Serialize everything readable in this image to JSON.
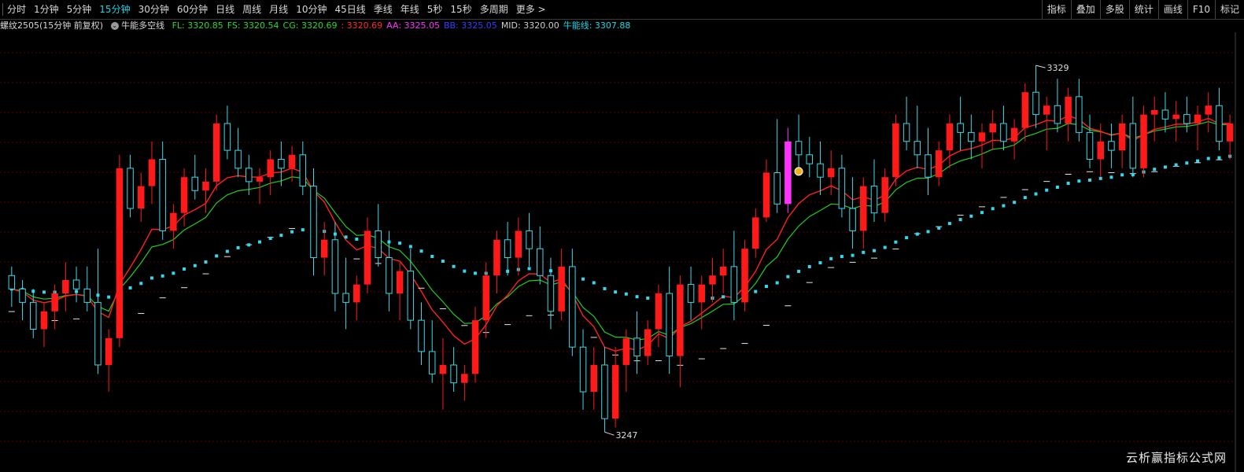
{
  "toolbar": {
    "periods": [
      "分时",
      "1分钟",
      "5分钟",
      "15分钟",
      "30分钟",
      "60分钟",
      "日线",
      "周线",
      "月线",
      "10分钟",
      "45日线",
      "季线",
      "年线",
      "5秒",
      "15秒",
      "多周期",
      "更多 >"
    ],
    "active_index": 3,
    "right_tools": [
      "指标",
      "叠加",
      "多股",
      "统计",
      "画线",
      "F10",
      "标记"
    ]
  },
  "legend": {
    "symbol": "螺纹2505(15分钟 前复权)",
    "indicator_name": "牛能多空线",
    "items": [
      {
        "text": "FL: 3320.85",
        "color": "#2ed62e"
      },
      {
        "text": "FS: 3320.54",
        "color": "#2ed62e"
      },
      {
        "text": "CG: 3320.69",
        "color": "#2ed62e"
      },
      {
        "text": ": 3320.69",
        "color": "#ff2a2a"
      },
      {
        "text": "AA: 3325.05",
        "color": "#ff33ff"
      },
      {
        "text": "BB: 3325.05",
        "color": "#3b3bff"
      },
      {
        "text": "MID: 3320.00",
        "color": "#cfcfcf"
      },
      {
        "text": "牛能线: 3307.88",
        "color": "#19d5e6"
      }
    ]
  },
  "colors": {
    "up": "#ff1a1a",
    "down": "#3dd9e8",
    "fast_line": "#ff2020",
    "slow_line": "#22cc22",
    "dotted_line": "#34d8ec",
    "step_marks": "#e6e6e6",
    "grid": "#5a0000",
    "signal_bar": "#ff33ff"
  },
  "chart_data": {
    "type": "candlestick",
    "title": "螺纹2505(15分钟 前复权)",
    "ylim": [
      3240,
      3335
    ],
    "high_label": "3329",
    "low_label": "3247",
    "candles": [
      [
        3282,
        3284,
        3275,
        3279
      ],
      [
        3279,
        3281,
        3272,
        3276
      ],
      [
        3276,
        3279,
        3268,
        3270
      ],
      [
        3270,
        3276,
        3266,
        3274
      ],
      [
        3274,
        3280,
        3270,
        3278
      ],
      [
        3278,
        3285,
        3274,
        3281
      ],
      [
        3281,
        3284,
        3276,
        3279
      ],
      [
        3279,
        3284,
        3274,
        3276
      ],
      [
        3276,
        3288,
        3260,
        3262
      ],
      [
        3262,
        3270,
        3256,
        3268
      ],
      [
        3268,
        3309,
        3266,
        3306
      ],
      [
        3306,
        3309,
        3295,
        3297
      ],
      [
        3297,
        3305,
        3294,
        3302
      ],
      [
        3302,
        3312,
        3298,
        3308
      ],
      [
        3308,
        3312,
        3290,
        3292
      ],
      [
        3292,
        3298,
        3288,
        3296
      ],
      [
        3296,
        3306,
        3293,
        3304
      ],
      [
        3304,
        3309,
        3299,
        3301
      ],
      [
        3301,
        3306,
        3296,
        3303
      ],
      [
        3303,
        3318,
        3301,
        3316
      ],
      [
        3316,
        3320,
        3308,
        3310
      ],
      [
        3310,
        3315,
        3304,
        3306
      ],
      [
        3306,
        3309,
        3300,
        3303
      ],
      [
        3303,
        3306,
        3298,
        3304
      ],
      [
        3304,
        3310,
        3300,
        3308
      ],
      [
        3308,
        3312,
        3302,
        3306
      ],
      [
        3306,
        3311,
        3303,
        3309
      ],
      [
        3309,
        3312,
        3300,
        3302
      ],
      [
        3302,
        3306,
        3282,
        3286
      ],
      [
        3286,
        3294,
        3282,
        3290
      ],
      [
        3290,
        3294,
        3274,
        3278
      ],
      [
        3278,
        3286,
        3270,
        3276
      ],
      [
        3276,
        3282,
        3272,
        3280
      ],
      [
        3280,
        3295,
        3278,
        3292
      ],
      [
        3292,
        3298,
        3284,
        3286
      ],
      [
        3286,
        3292,
        3274,
        3278
      ],
      [
        3278,
        3285,
        3272,
        3283
      ],
      [
        3283,
        3288,
        3270,
        3272
      ],
      [
        3272,
        3276,
        3262,
        3265
      ],
      [
        3265,
        3272,
        3258,
        3260
      ],
      [
        3260,
        3268,
        3252,
        3262
      ],
      [
        3262,
        3266,
        3256,
        3258
      ],
      [
        3258,
        3262,
        3254,
        3260
      ],
      [
        3260,
        3275,
        3258,
        3272
      ],
      [
        3272,
        3285,
        3268,
        3282
      ],
      [
        3282,
        3292,
        3278,
        3290
      ],
      [
        3290,
        3294,
        3282,
        3286
      ],
      [
        3286,
        3295,
        3282,
        3292
      ],
      [
        3292,
        3296,
        3284,
        3288
      ],
      [
        3288,
        3293,
        3280,
        3282
      ],
      [
        3282,
        3286,
        3270,
        3274
      ],
      [
        3274,
        3288,
        3272,
        3284
      ],
      [
        3284,
        3288,
        3264,
        3266
      ],
      [
        3266,
        3270,
        3252,
        3256
      ],
      [
        3256,
        3266,
        3252,
        3262
      ],
      [
        3262,
        3266,
        3247,
        3250
      ],
      [
        3250,
        3266,
        3248,
        3262
      ],
      [
        3262,
        3270,
        3256,
        3268
      ],
      [
        3268,
        3274,
        3260,
        3264
      ],
      [
        3264,
        3272,
        3262,
        3270
      ],
      [
        3270,
        3280,
        3266,
        3278
      ],
      [
        3278,
        3284,
        3260,
        3264
      ],
      [
        3264,
        3282,
        3257,
        3280
      ],
      [
        3280,
        3284,
        3272,
        3276
      ],
      [
        3276,
        3282,
        3270,
        3280
      ],
      [
        3280,
        3286,
        3276,
        3282
      ],
      [
        3282,
        3288,
        3278,
        3284
      ],
      [
        3284,
        3292,
        3272,
        3276
      ],
      [
        3276,
        3290,
        3274,
        3288
      ],
      [
        3288,
        3297,
        3286,
        3295
      ],
      [
        3295,
        3308,
        3294,
        3305
      ],
      [
        3305,
        3317,
        3296,
        3298
      ],
      [
        3298,
        3315,
        3296,
        3312
      ],
      [
        3312,
        3318,
        3306,
        3309
      ],
      [
        3309,
        3313,
        3304,
        3307
      ],
      [
        3307,
        3312,
        3300,
        3304
      ],
      [
        3304,
        3310,
        3300,
        3306
      ],
      [
        3306,
        3309,
        3295,
        3297
      ],
      [
        3297,
        3304,
        3288,
        3292
      ],
      [
        3292,
        3304,
        3288,
        3302
      ],
      [
        3302,
        3308,
        3294,
        3296
      ],
      [
        3296,
        3306,
        3294,
        3304
      ],
      [
        3304,
        3318,
        3302,
        3316
      ],
      [
        3316,
        3322,
        3310,
        3312
      ],
      [
        3312,
        3320,
        3306,
        3309
      ],
      [
        3309,
        3315,
        3300,
        3304
      ],
      [
        3304,
        3312,
        3302,
        3310
      ],
      [
        3310,
        3318,
        3306,
        3316
      ],
      [
        3316,
        3322,
        3310,
        3314
      ],
      [
        3314,
        3318,
        3308,
        3312
      ],
      [
        3312,
        3316,
        3306,
        3314
      ],
      [
        3314,
        3319,
        3310,
        3316
      ],
      [
        3316,
        3320,
        3310,
        3312
      ],
      [
        3312,
        3317,
        3308,
        3315
      ],
      [
        3315,
        3325,
        3312,
        3323
      ],
      [
        3323,
        3329,
        3315,
        3318
      ],
      [
        3318,
        3322,
        3310,
        3320
      ],
      [
        3320,
        3326,
        3314,
        3316
      ],
      [
        3316,
        3324,
        3312,
        3322
      ],
      [
        3322,
        3326,
        3312,
        3314
      ],
      [
        3314,
        3318,
        3306,
        3308
      ],
      [
        3308,
        3316,
        3304,
        3312
      ],
      [
        3312,
        3316,
        3306,
        3310
      ],
      [
        3310,
        3318,
        3306,
        3316
      ],
      [
        3316,
        3322,
        3304,
        3306
      ],
      [
        3306,
        3320,
        3304,
        3318
      ],
      [
        3318,
        3322,
        3312,
        3319
      ],
      [
        3319,
        3323,
        3314,
        3317
      ],
      [
        3317,
        3321,
        3312,
        3318
      ],
      [
        3318,
        3322,
        3314,
        3316
      ],
      [
        3316,
        3320,
        3310,
        3318
      ],
      [
        3318,
        3323,
        3314,
        3320
      ],
      [
        3320,
        3324,
        3310,
        3312
      ],
      [
        3312,
        3318,
        3308,
        3316
      ]
    ],
    "signal_bar_index": 72,
    "coin_marker_index": 73
  },
  "watermark": "云析赢指标公式网"
}
